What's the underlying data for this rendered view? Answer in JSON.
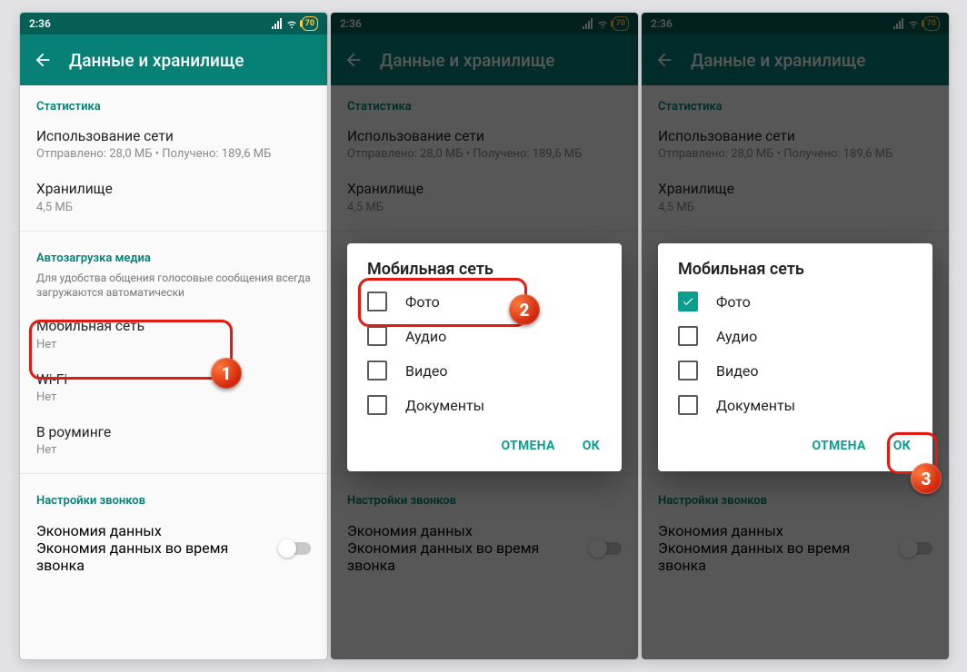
{
  "status": {
    "time": "2:36",
    "battery": "70"
  },
  "appbar": {
    "title": "Данные и хранилище"
  },
  "sections": {
    "stats_header": "Статистика",
    "net_usage_title": "Использование сети",
    "net_usage_sub": "Отправлено: 28,0 МБ • Получено: 189,6 МБ",
    "storage_title": "Хранилище",
    "storage_sub": "4,5 МБ",
    "autoload_header": "Автозагрузка медиа",
    "autoload_desc": "Для удобства общения голосовые сообщения всегда загружаются автоматически",
    "mobile_title": "Мобильная сеть",
    "mobile_sub": "Нет",
    "wifi_title": "Wi-Fi",
    "wifi_sub": "Нет",
    "roaming_title": "В роуминге",
    "roaming_sub": "Нет",
    "calls_header": "Настройки звонков",
    "econ_title": "Экономия данных",
    "econ_sub": "Экономия данных во время звонка"
  },
  "dialog": {
    "title": "Мобильная сеть",
    "opts": {
      "photo": "Фото",
      "audio": "Аудио",
      "video": "Видео",
      "docs": "Документы"
    },
    "cancel": "ОТМЕНА",
    "ok": "ОК"
  },
  "callouts": {
    "n1": "1",
    "n2": "2",
    "n3": "3"
  }
}
